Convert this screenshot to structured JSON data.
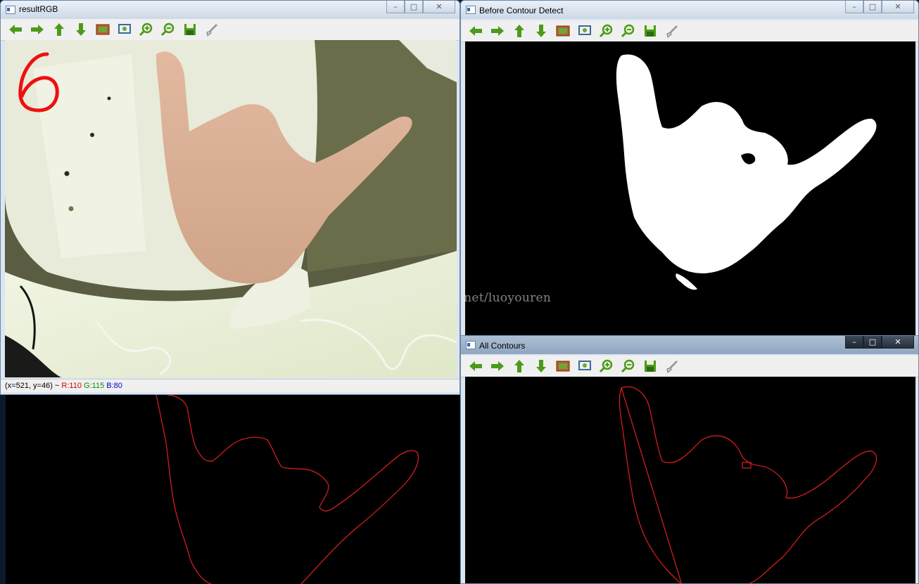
{
  "colors": {
    "toolbar_green": "#4c9a1a",
    "contour_red": "#e02020",
    "rgb_r": "#d40000",
    "rgb_g": "#0b8a00",
    "rgb_b": "#0000c8"
  },
  "toolbar_icons": [
    "arrow-left-icon",
    "arrow-right-icon",
    "arrow-up-icon",
    "arrow-down-icon",
    "image-icon",
    "zoom-fit-icon",
    "zoom-in-icon",
    "zoom-out-icon",
    "save-icon",
    "properties-icon"
  ],
  "win_rgb": {
    "title": "resultRGB",
    "overlay_digit": "6",
    "status_coords": "(x=521, y=46) ~ ",
    "status_r": "R:110",
    "status_g": "G:115",
    "status_b": "B:80"
  },
  "win_before": {
    "title": "Before Contour Detect"
  },
  "win_contours": {
    "title": "All Contours"
  },
  "watermark": "http://blog.csdn.net/luoyouren"
}
